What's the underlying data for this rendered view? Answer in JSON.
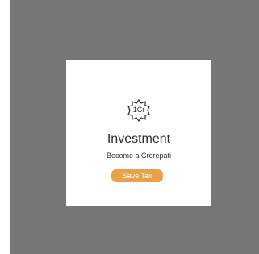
{
  "card": {
    "badge_text": "1Cr",
    "title": "Investment",
    "subtitle": "Become a Crorepati",
    "tag": "Save Tax",
    "icon": "certificate-badge-icon",
    "colors": {
      "backdrop": "#777777",
      "card": "#ffffff",
      "tag": "#e8a24a"
    }
  }
}
